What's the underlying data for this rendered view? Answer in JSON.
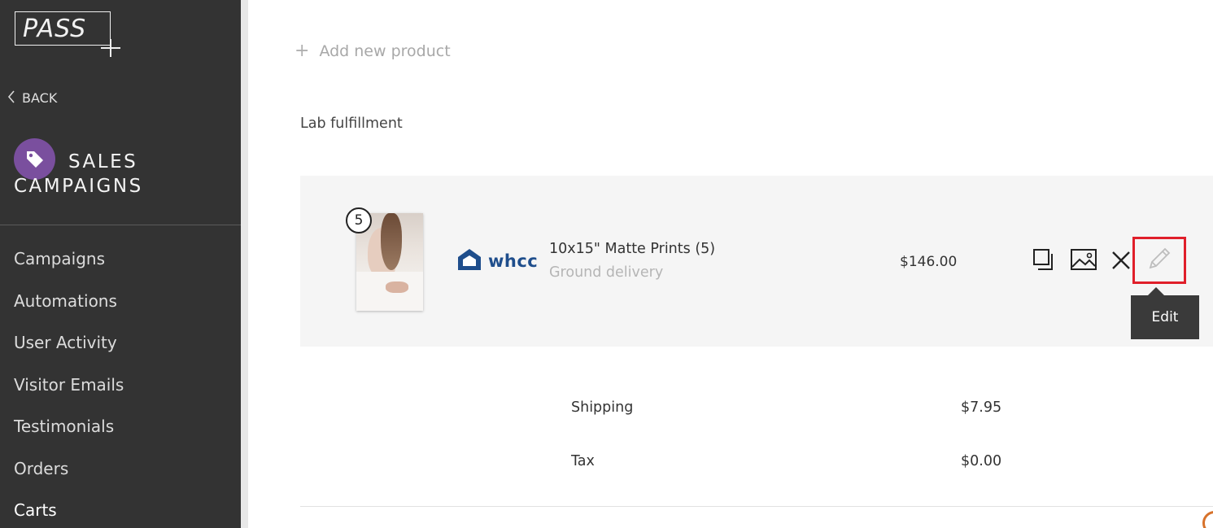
{
  "sidebar": {
    "logo_text": "PASS",
    "back_label": "BACK",
    "section_title_line1": "SALES",
    "section_title_line2": "CAMPAIGNS",
    "section_icon": "tag-icon",
    "accent_color": "#7a4f9e",
    "nav": [
      {
        "label": "Campaigns"
      },
      {
        "label": "Automations"
      },
      {
        "label": "User Activity"
      },
      {
        "label": "Visitor Emails"
      },
      {
        "label": "Testimonials"
      },
      {
        "label": "Orders"
      },
      {
        "label": "Carts"
      }
    ],
    "active_item": "Carts"
  },
  "main": {
    "add_product_label": "Add new product",
    "fulfillment_label": "Lab fulfillment",
    "product": {
      "quantity_badge": "5",
      "vendor": "whcc",
      "name": "10x15\" Matte Prints (5)",
      "delivery": "Ground delivery",
      "price": "$146.00",
      "actions": [
        {
          "icon": "duplicate-icon"
        },
        {
          "icon": "image-icon"
        },
        {
          "icon": "close-icon"
        },
        {
          "icon": "pencil-icon"
        }
      ],
      "tooltip": "Edit",
      "highlight_color": "#e01f2a"
    },
    "summary": [
      {
        "label": "Shipping",
        "value": "$7.95"
      },
      {
        "label": "Tax",
        "value": "$0.00"
      }
    ]
  }
}
